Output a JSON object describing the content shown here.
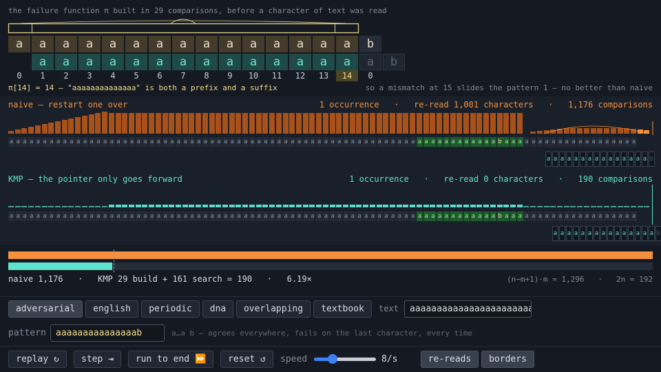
{
  "header": {
    "caption": "the failure function π  built in 29 comparisons, before a character of text was read"
  },
  "text_row": [
    "a",
    "a",
    "a",
    "a",
    "a",
    "a",
    "a",
    "a",
    "a",
    "a",
    "a",
    "a",
    "a",
    "a",
    "a",
    "b"
  ],
  "pattern_row": [
    "a",
    "a",
    "a",
    "a",
    "a",
    "a",
    "a",
    "a",
    "a",
    "a",
    "a",
    "a",
    "a",
    "a",
    "a",
    "b"
  ],
  "pi_values": [
    "0",
    "1",
    "2",
    "3",
    "4",
    "5",
    "6",
    "7",
    "8",
    "9",
    "10",
    "11",
    "12",
    "13",
    "14",
    "0"
  ],
  "highlight_index": 14,
  "pi_note": "π[14] = 14 — \"aaaaaaaaaaaaaa\" is both a prefix and a suffix",
  "slide_note": "so a mismatch at 15 slides the pattern 1 — no better than naive",
  "naive": {
    "title": "naive — restart one over",
    "occurrences": "1 occurrence",
    "rereads": "re-read 1,001 characters",
    "comparisons": "1,176 comparisons",
    "sep": "·"
  },
  "kmp": {
    "title": "KMP — the pointer only goes forward",
    "occurrences": "1 occurrence",
    "rereads": "re-read 0 characters",
    "comparisons": "190 comparisons",
    "sep": "·"
  },
  "lane_text": "aaaaaaaaaaaaaaaaaaaaaaaaaaaaaaaaaaaaaaaaaaaaaaaaaaaaaaaaaaaaaaaaaaaaaaaaab",
  "lane_window_naive": "aaaaaaaaaaaaaaab",
  "lane_window_kmp": "aaaaaaaaaaaaaaab",
  "compare": {
    "naive_fill": 1.0,
    "kmp_fill": 0.1616,
    "summary_naive": "naive 1,176",
    "summary_kmp": "KMP 29 build + 161 search = 190",
    "summary_ratio": "6.19×",
    "sep": "·",
    "bound_naive": "(n−m+1)·m = 1,296",
    "bound_kmp": "2n = 192",
    "naive_color": "#f5903d",
    "kmp_color": "#5ee3cc"
  },
  "presets": [
    "adversarial",
    "english",
    "periodic",
    "dna",
    "overlapping",
    "textbook"
  ],
  "active_preset": "adversarial",
  "text_label": "text",
  "text_value": "aaaaaaaaaaaaaaaaaaaaaaaaaaaaaaaaaaaaaaaaaaaaaaaaaaaaaaaaaaaab",
  "pattern_label": "pattern",
  "pattern_value": "aaaaaaaaaaaaaaab",
  "pattern_hint": "a…a b — agrees everywhere, fails on the last character, every time",
  "controls": {
    "replay": "replay ↻",
    "step": "step ⇥",
    "run": "run to end ⏩",
    "reset": "reset ↺",
    "speed_label": "speed",
    "speed_value": "8/s",
    "speed_level": 0.3,
    "toggle_rereads": "re-reads",
    "toggle_borders": "borders"
  }
}
